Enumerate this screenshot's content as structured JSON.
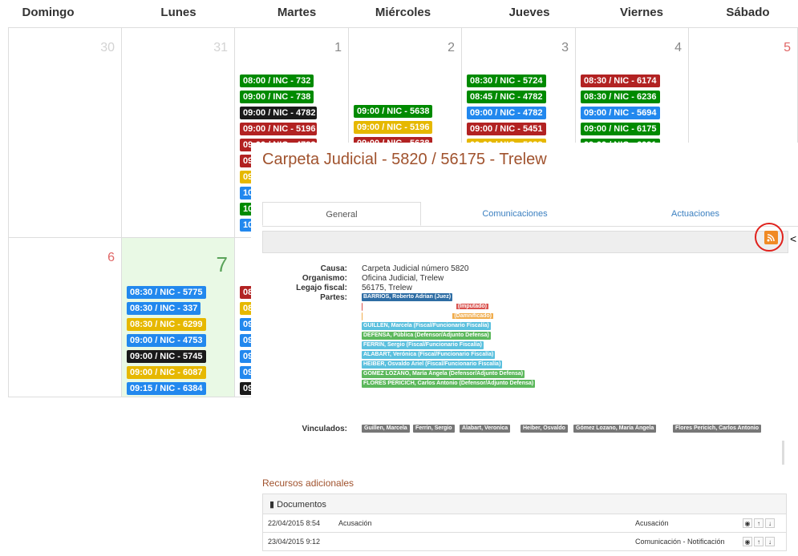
{
  "calendar": {
    "weekdays": [
      "Domingo",
      "Lunes",
      "Martes",
      "Miércoles",
      "Jueves",
      "Viernes",
      "Sábado"
    ],
    "week1": {
      "days": [
        "30",
        "31",
        "1",
        "2",
        "3",
        "4",
        "5"
      ],
      "martes_events": [
        {
          "label": "08:00 / INC - 732",
          "color": "green"
        },
        {
          "label": "09:00 / INC - 738",
          "color": "green"
        },
        {
          "label": "09:00 / NIC - 4782",
          "color": "black"
        },
        {
          "label": "09:00 / NIC - 5196",
          "color": "red"
        },
        {
          "label": "09:00 / NIC - 4782",
          "color": "red"
        },
        {
          "label": "09",
          "color": "red"
        },
        {
          "label": "09:",
          "color": "yellow"
        },
        {
          "label": "10:",
          "color": "blue"
        },
        {
          "label": "10:",
          "color": "green"
        },
        {
          "label": "10:",
          "color": "blue"
        }
      ],
      "miercoles_events": [
        {
          "label": "09:00 / NIC - 5638",
          "color": "green"
        },
        {
          "label": "09:00 / NIC - 5196",
          "color": "yellow"
        },
        {
          "label": "09:00 / NIC - 5638",
          "color": "red"
        }
      ],
      "jueves_events": [
        {
          "label": "08:30 / NIC - 5724",
          "color": "green"
        },
        {
          "label": "08:45 / NIC - 4782",
          "color": "green"
        },
        {
          "label": "09:00 / NIC - 4782",
          "color": "blue"
        },
        {
          "label": "09:00 / NIC - 5451",
          "color": "red"
        },
        {
          "label": "09:00 / NIC - 5638",
          "color": "yellow"
        }
      ],
      "viernes_events": [
        {
          "label": "08:30 / NIC - 6174",
          "color": "red"
        },
        {
          "label": "08:30 / NIC - 6236",
          "color": "green"
        },
        {
          "label": "09:00 / NIC - 5694",
          "color": "blue"
        },
        {
          "label": "09:00 / NIC - 6175",
          "color": "green"
        },
        {
          "label": "09:00 / NIC - 6091",
          "color": "green"
        }
      ]
    },
    "week2": {
      "days": [
        "6",
        "7"
      ],
      "lunes_events": [
        {
          "label": "08:30 / NIC - 5775",
          "color": "blue"
        },
        {
          "label": "08:30 / INC - 337",
          "color": "blue"
        },
        {
          "label": "08:30 / NIC - 6299",
          "color": "yellow"
        },
        {
          "label": "09:00 / NIC - 4753",
          "color": "blue"
        },
        {
          "label": "09:00 / NIC - 5745",
          "color": "black"
        },
        {
          "label": "09:00 / NIC - 6087",
          "color": "yellow"
        },
        {
          "label": "09:15 / NIC - 6384",
          "color": "blue"
        }
      ],
      "martes_events": [
        {
          "label": "08:",
          "color": "red"
        },
        {
          "label": "08:",
          "color": "yellow"
        },
        {
          "label": "09:",
          "color": "blue"
        },
        {
          "label": "09:",
          "color": "blue"
        },
        {
          "label": "09:",
          "color": "blue"
        },
        {
          "label": "09:",
          "color": "blue"
        },
        {
          "label": "09:",
          "color": "black"
        },
        {
          "label": "09:",
          "color": "blue"
        }
      ]
    }
  },
  "modal": {
    "title": "Carpeta Judicial - 5820 / 56175 - Trelew",
    "tabs": [
      "General",
      "Comunicaciones",
      "Actuaciones"
    ],
    "causa_label": "Causa:",
    "causa_value": "Carpeta Judicial número 5820",
    "organismo_label": "Organismo:",
    "organismo_value": "Oficina Judicial, Trelew",
    "legajo_label": "Legajo fiscal:",
    "legajo_value": "56175, Trelew",
    "partes_label": "Partes:",
    "partes": [
      {
        "label": "BARRIOS, Roberto Adrian (Juez)",
        "color": "dark"
      },
      {
        "label": "(Imputado)",
        "color": "red"
      },
      {
        "label": "(Damnificado)",
        "color": "orange"
      },
      {
        "label": "GUILLEN, Marcela (Fiscal/Funcionario Fiscalía)",
        "color": "cyan"
      },
      {
        "label": "DEFENSA, Pública (Defensor/Adjunto Defensa)",
        "color": "green"
      },
      {
        "label": "FERRIN, Sergio (Fiscal/Funcionario Fiscalía)",
        "color": "cyan"
      },
      {
        "label": "ALABART, Verónica (Fiscal/Funcionario Fiscalía)",
        "color": "cyan"
      },
      {
        "label": "HEIBER, Osvaldo Ariel (Fiscal/Funcionario Fiscalía)",
        "color": "cyan"
      },
      {
        "label": "GOMEZ LOZANO, María Ángela (Defensor/Adjunto Defensa)",
        "color": "green"
      },
      {
        "label": "FLORES PERICICH, Carlos Antonio (Defensor/Adjunto Defensa)",
        "color": "green"
      }
    ],
    "vinculados_label": "Vinculados:",
    "vinculados": [
      "Guillen, Marcela",
      "Ferrin, Sergio",
      "Alabart, Veronica",
      "Heiber, Osvaldo",
      "Gómez Lozano, María Ángela",
      "Flores Pericich, Carlos Antonio"
    ],
    "recursos_title": "Recursos adicionales",
    "documentos_label": "Documentos",
    "documents": [
      {
        "date": "22/04/2015 8:54",
        "title": "Acusación",
        "kind": "Acusación"
      },
      {
        "date": "23/04/2015 9:12",
        "title": "",
        "kind": "Comunicación - Notificación"
      }
    ]
  },
  "colors": {
    "accent": "#a0522d",
    "rss": "#f08a24",
    "highlight": "#e0211c"
  }
}
